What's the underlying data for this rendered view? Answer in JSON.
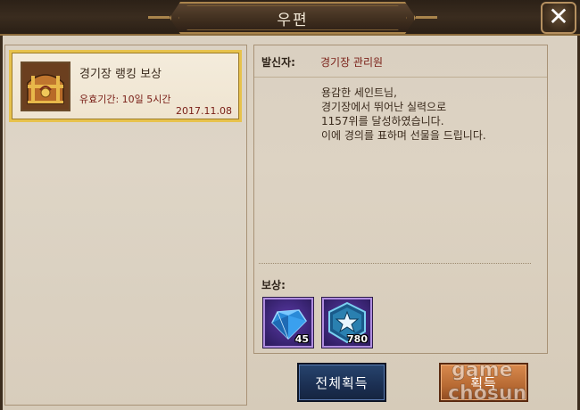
{
  "window": {
    "title": "우편"
  },
  "mail_list": {
    "items": [
      {
        "title": "경기장 랭킹 보상",
        "expiry": "유효기간: 10일 5시간",
        "date": "2017.11.08",
        "icon": "treasure-chest-icon"
      }
    ]
  },
  "detail": {
    "sender_label": "발신자:",
    "sender_name": "경기장 관리원",
    "body_lines": [
      "용감한 세인트님,",
      "경기장에서 뛰어난 실력으로",
      "1157위를 달성하였습니다.",
      "이에 경의를 표하며 선물을 드립니다."
    ],
    "reward_label": "보상:",
    "rewards": [
      {
        "icon": "blue-diamond-icon",
        "count": "45"
      },
      {
        "icon": "star-medal-icon",
        "count": "780"
      }
    ]
  },
  "buttons": {
    "claim_all": "전체획득",
    "claim": "획득"
  },
  "watermark": {
    "line1": "game",
    "line2": "chosun"
  },
  "colors": {
    "accent_red": "#7a2018",
    "selected_border": "#e7c24c",
    "claim_all_bg": "#1b2f52",
    "claim_bg": "#b76a33"
  }
}
